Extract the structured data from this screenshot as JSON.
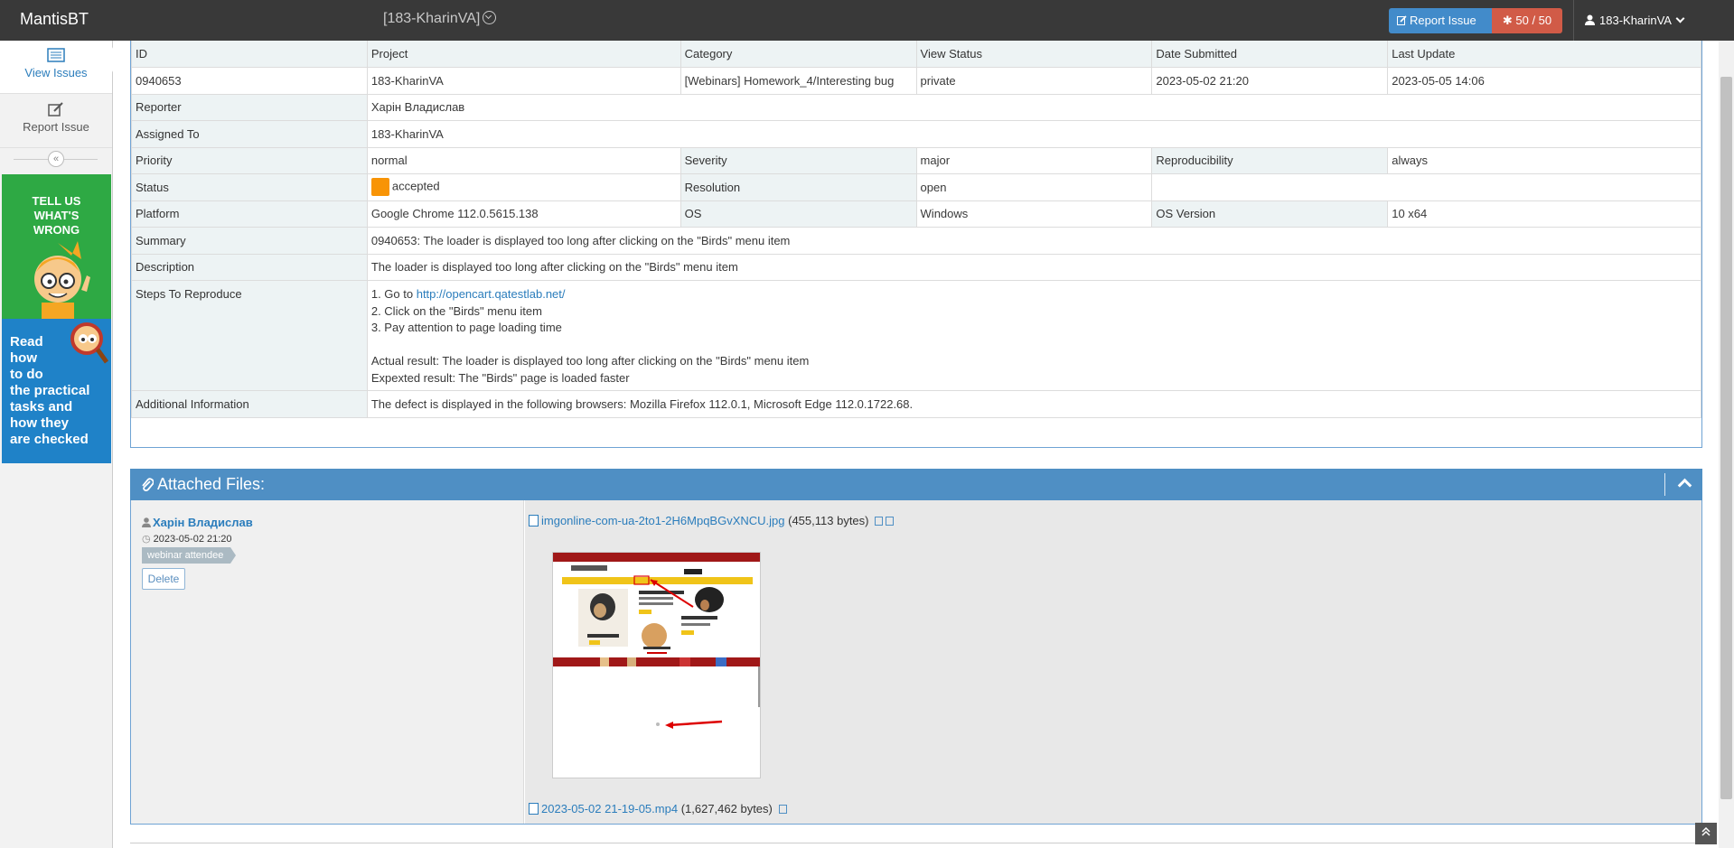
{
  "navbar": {
    "brand": "MantisBT",
    "project": "[183-KharinVA]",
    "report_issue": "Report Issue",
    "issue_count": "50 / 50",
    "user": "183-KharinVA"
  },
  "sidebar": {
    "view_issues": "View Issues",
    "report_issue": "Report Issue",
    "collapse": "«",
    "banner1": [
      "TELL US",
      "WHAT'S",
      "WRONG"
    ],
    "banner2": [
      "Read",
      "how",
      "to do",
      "the practical",
      "tasks and",
      "how they",
      "are checked"
    ]
  },
  "issue": {
    "headers": [
      "ID",
      "Project",
      "Category",
      "View Status",
      "Date Submitted",
      "Last Update"
    ],
    "values": [
      "0940653",
      "183-KharinVA",
      "[Webinars] Homework_4/Interesting bug",
      "private",
      "2023-05-02 21:20",
      "2023-05-05 14:06"
    ],
    "reporter_label": "Reporter",
    "reporter": "Харін Владислав",
    "assigned_label": "Assigned To",
    "assigned": "183-KharinVA",
    "priority_label": "Priority",
    "priority": "normal",
    "severity_label": "Severity",
    "severity": "major",
    "reproducibility_label": "Reproducibility",
    "reproducibility": "always",
    "status_label": "Status",
    "status": "accepted",
    "status_color": "#f89406",
    "resolution_label": "Resolution",
    "resolution": "open",
    "platform_label": "Platform",
    "platform": "Google Chrome 112.0.5615.138",
    "os_label": "OS",
    "os": "Windows",
    "os_version_label": "OS Version",
    "os_version": "10 x64",
    "summary_label": "Summary",
    "summary": "0940653: The loader is displayed too long after clicking on the \"Birds\" menu item",
    "description_label": "Description",
    "description": "The loader is displayed too long after clicking on the \"Birds\" menu item",
    "steps_label": "Steps To Reproduce",
    "step1_prefix": "1. Go to ",
    "step1_link": "http://opencart.qatestlab.net/",
    "step2": "2. Click on the \"Birds\" menu item",
    "step3": "3. Pay attention to page loading time",
    "actual": "Actual result: The loader is displayed too long after clicking on the \"Birds\" menu item",
    "expected": "Expexted result: The \"Birds\" page is loaded faster",
    "additional_label": "Additional Information",
    "additional": "The defect is displayed in the following browsers: Mozilla Firefox 112.0.1, Microsoft Edge 112.0.1722.68."
  },
  "attachments": {
    "title": "Attached Files:",
    "author": "Харін Владислав",
    "date": "2023-05-02 21:20",
    "badge": "webinar attendee",
    "delete": "Delete",
    "file1_name": "imgonline-com-ua-2to1-2H6MpqBGvXNCU.jpg",
    "file1_size": "(455,113 bytes)",
    "file2_name": "2023-05-02 21-19-05.mp4",
    "file2_size": "(1,627,462 bytes)"
  }
}
